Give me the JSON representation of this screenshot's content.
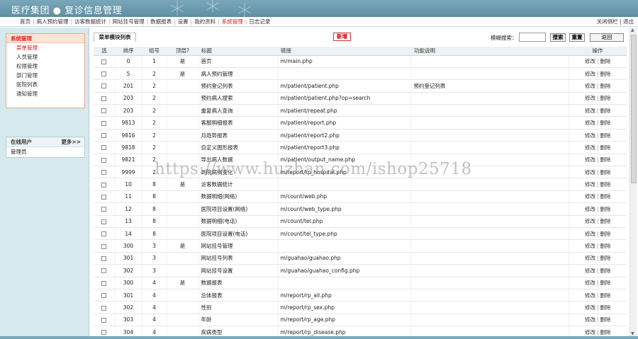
{
  "app": {
    "title": "医疗集团 ● 复诊信息管理"
  },
  "nav": {
    "items": [
      {
        "label": "首页"
      },
      {
        "label": "病人预约管理"
      },
      {
        "label": "访客数据统计"
      },
      {
        "label": "网站挂号管理"
      },
      {
        "label": "数据报表"
      },
      {
        "label": "设置"
      },
      {
        "label": "我的资料"
      },
      {
        "label": "系统管理",
        "active": true
      },
      {
        "label": "日志记录"
      }
    ],
    "right": "关闭侧栏 | 退出"
  },
  "sidebar": {
    "menu_title": "系统管理",
    "items": [
      {
        "label": "菜单管理",
        "active": true
      },
      {
        "label": "人员管理"
      },
      {
        "label": "权限管理"
      },
      {
        "label": "部门管理"
      },
      {
        "label": "医院列表"
      },
      {
        "label": "通知管理"
      }
    ],
    "online_title": "在线用户",
    "online_more": "更多>>",
    "online_users": [
      "管理员"
    ]
  },
  "toolbar": {
    "tab": "菜单模块列表",
    "add": "新增",
    "search_label": "模糊搜索：",
    "search_value": "",
    "search_btn": "搜索",
    "reset_btn": "重置",
    "back_btn": "返回"
  },
  "table": {
    "headers": [
      "选",
      "排序",
      "组号",
      "顶层?",
      "标题",
      "链接",
      "功能说明",
      "操作"
    ],
    "op_edit": "修改",
    "op_delete": "删除",
    "rows": [
      {
        "sort": "0",
        "group": "1",
        "top": "是",
        "title": "首页",
        "link": "m/main.php",
        "desc": ""
      },
      {
        "sort": "5",
        "group": "2",
        "top": "是",
        "title": "病人预约管理",
        "link": "",
        "desc": ""
      },
      {
        "sort": "201",
        "group": "2",
        "top": "",
        "title": "预约登记列表",
        "link": "m/patient/patient.php",
        "desc": "预约登记列表"
      },
      {
        "sort": "203",
        "group": "2",
        "top": "",
        "title": "预约病人搜索",
        "link": "m/patient/patient.php?op=search",
        "desc": ""
      },
      {
        "sort": "203",
        "group": "2",
        "top": "",
        "title": "重复病人查询",
        "link": "m/patient/repeat.php",
        "desc": ""
      },
      {
        "sort": "9813",
        "group": "2",
        "top": "",
        "title": "客服明细报表",
        "link": "m/patient/report.php",
        "desc": ""
      },
      {
        "sort": "9816",
        "group": "2",
        "top": "",
        "title": "月趋势报表",
        "link": "m/patient/report2.php",
        "desc": ""
      },
      {
        "sort": "9818",
        "group": "2",
        "top": "",
        "title": "自定义图形报表",
        "link": "m/patient/report3.php",
        "desc": ""
      },
      {
        "sort": "9821",
        "group": "2",
        "top": "",
        "title": "导出病人数据",
        "link": "m/patient/output_name.php",
        "desc": ""
      },
      {
        "sort": "9999",
        "group": "2",
        "top": "",
        "title": "到院病例变化",
        "link": "m/report/rp_hospital.php",
        "desc": ""
      },
      {
        "sort": "10",
        "group": "8",
        "top": "是",
        "title": "访客数据统计",
        "link": "",
        "desc": ""
      },
      {
        "sort": "11",
        "group": "8",
        "top": "",
        "title": "数据明细(网络)",
        "link": "m/count/web.php",
        "desc": ""
      },
      {
        "sort": "12",
        "group": "8",
        "top": "",
        "title": "医院项目设置(网络)",
        "link": "m/count/web_type.php",
        "desc": ""
      },
      {
        "sort": "13",
        "group": "8",
        "top": "",
        "title": "数据明细(电话)",
        "link": "m/count/tel.php",
        "desc": ""
      },
      {
        "sort": "14",
        "group": "8",
        "top": "",
        "title": "医院项目设置(电话)",
        "link": "m/count/tel_type.php",
        "desc": ""
      },
      {
        "sort": "300",
        "group": "3",
        "top": "是",
        "title": "网站挂号管理",
        "link": "",
        "desc": ""
      },
      {
        "sort": "301",
        "group": "3",
        "top": "",
        "title": "网站挂号列表",
        "link": "m/guahao/guahao.php",
        "desc": ""
      },
      {
        "sort": "302",
        "group": "3",
        "top": "",
        "title": "网站挂号设置",
        "link": "m/guahao/guahao_config.php",
        "desc": ""
      },
      {
        "sort": "300",
        "group": "4",
        "top": "是",
        "title": "数据报表",
        "link": "",
        "desc": ""
      },
      {
        "sort": "301",
        "group": "4",
        "top": "",
        "title": "总体报表",
        "link": "m/report/rp_all.php",
        "desc": ""
      },
      {
        "sort": "302",
        "group": "4",
        "top": "",
        "title": "性别",
        "link": "m/report/rp_sex.php",
        "desc": ""
      },
      {
        "sort": "303",
        "group": "4",
        "top": "",
        "title": "年龄",
        "link": "m/report/rp_age.php",
        "desc": ""
      },
      {
        "sort": "304",
        "group": "4",
        "top": "",
        "title": "疾病类型",
        "link": "m/report/rp_disease.php",
        "desc": ""
      }
    ]
  },
  "watermark": "https://www.huzhan.com/ishop25718"
}
